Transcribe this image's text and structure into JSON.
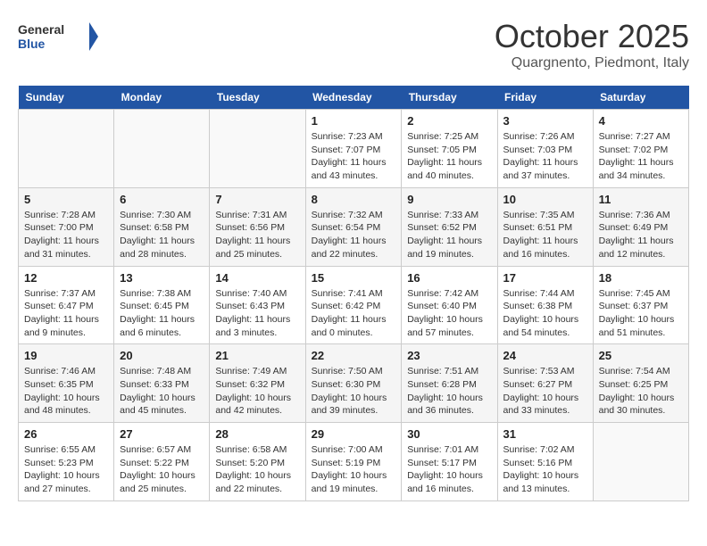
{
  "header": {
    "logo_general": "General",
    "logo_blue": "Blue",
    "month_title": "October 2025",
    "subtitle": "Quargnento, Piedmont, Italy"
  },
  "weekdays": [
    "Sunday",
    "Monday",
    "Tuesday",
    "Wednesday",
    "Thursday",
    "Friday",
    "Saturday"
  ],
  "weeks": [
    [
      {
        "day": "",
        "info": ""
      },
      {
        "day": "",
        "info": ""
      },
      {
        "day": "",
        "info": ""
      },
      {
        "day": "1",
        "info": "Sunrise: 7:23 AM\nSunset: 7:07 PM\nDaylight: 11 hours and 43 minutes."
      },
      {
        "day": "2",
        "info": "Sunrise: 7:25 AM\nSunset: 7:05 PM\nDaylight: 11 hours and 40 minutes."
      },
      {
        "day": "3",
        "info": "Sunrise: 7:26 AM\nSunset: 7:03 PM\nDaylight: 11 hours and 37 minutes."
      },
      {
        "day": "4",
        "info": "Sunrise: 7:27 AM\nSunset: 7:02 PM\nDaylight: 11 hours and 34 minutes."
      }
    ],
    [
      {
        "day": "5",
        "info": "Sunrise: 7:28 AM\nSunset: 7:00 PM\nDaylight: 11 hours and 31 minutes."
      },
      {
        "day": "6",
        "info": "Sunrise: 7:30 AM\nSunset: 6:58 PM\nDaylight: 11 hours and 28 minutes."
      },
      {
        "day": "7",
        "info": "Sunrise: 7:31 AM\nSunset: 6:56 PM\nDaylight: 11 hours and 25 minutes."
      },
      {
        "day": "8",
        "info": "Sunrise: 7:32 AM\nSunset: 6:54 PM\nDaylight: 11 hours and 22 minutes."
      },
      {
        "day": "9",
        "info": "Sunrise: 7:33 AM\nSunset: 6:52 PM\nDaylight: 11 hours and 19 minutes."
      },
      {
        "day": "10",
        "info": "Sunrise: 7:35 AM\nSunset: 6:51 PM\nDaylight: 11 hours and 16 minutes."
      },
      {
        "day": "11",
        "info": "Sunrise: 7:36 AM\nSunset: 6:49 PM\nDaylight: 11 hours and 12 minutes."
      }
    ],
    [
      {
        "day": "12",
        "info": "Sunrise: 7:37 AM\nSunset: 6:47 PM\nDaylight: 11 hours and 9 minutes."
      },
      {
        "day": "13",
        "info": "Sunrise: 7:38 AM\nSunset: 6:45 PM\nDaylight: 11 hours and 6 minutes."
      },
      {
        "day": "14",
        "info": "Sunrise: 7:40 AM\nSunset: 6:43 PM\nDaylight: 11 hours and 3 minutes."
      },
      {
        "day": "15",
        "info": "Sunrise: 7:41 AM\nSunset: 6:42 PM\nDaylight: 11 hours and 0 minutes."
      },
      {
        "day": "16",
        "info": "Sunrise: 7:42 AM\nSunset: 6:40 PM\nDaylight: 10 hours and 57 minutes."
      },
      {
        "day": "17",
        "info": "Sunrise: 7:44 AM\nSunset: 6:38 PM\nDaylight: 10 hours and 54 minutes."
      },
      {
        "day": "18",
        "info": "Sunrise: 7:45 AM\nSunset: 6:37 PM\nDaylight: 10 hours and 51 minutes."
      }
    ],
    [
      {
        "day": "19",
        "info": "Sunrise: 7:46 AM\nSunset: 6:35 PM\nDaylight: 10 hours and 48 minutes."
      },
      {
        "day": "20",
        "info": "Sunrise: 7:48 AM\nSunset: 6:33 PM\nDaylight: 10 hours and 45 minutes."
      },
      {
        "day": "21",
        "info": "Sunrise: 7:49 AM\nSunset: 6:32 PM\nDaylight: 10 hours and 42 minutes."
      },
      {
        "day": "22",
        "info": "Sunrise: 7:50 AM\nSunset: 6:30 PM\nDaylight: 10 hours and 39 minutes."
      },
      {
        "day": "23",
        "info": "Sunrise: 7:51 AM\nSunset: 6:28 PM\nDaylight: 10 hours and 36 minutes."
      },
      {
        "day": "24",
        "info": "Sunrise: 7:53 AM\nSunset: 6:27 PM\nDaylight: 10 hours and 33 minutes."
      },
      {
        "day": "25",
        "info": "Sunrise: 7:54 AM\nSunset: 6:25 PM\nDaylight: 10 hours and 30 minutes."
      }
    ],
    [
      {
        "day": "26",
        "info": "Sunrise: 6:55 AM\nSunset: 5:23 PM\nDaylight: 10 hours and 27 minutes."
      },
      {
        "day": "27",
        "info": "Sunrise: 6:57 AM\nSunset: 5:22 PM\nDaylight: 10 hours and 25 minutes."
      },
      {
        "day": "28",
        "info": "Sunrise: 6:58 AM\nSunset: 5:20 PM\nDaylight: 10 hours and 22 minutes."
      },
      {
        "day": "29",
        "info": "Sunrise: 7:00 AM\nSunset: 5:19 PM\nDaylight: 10 hours and 19 minutes."
      },
      {
        "day": "30",
        "info": "Sunrise: 7:01 AM\nSunset: 5:17 PM\nDaylight: 10 hours and 16 minutes."
      },
      {
        "day": "31",
        "info": "Sunrise: 7:02 AM\nSunset: 5:16 PM\nDaylight: 10 hours and 13 minutes."
      },
      {
        "day": "",
        "info": ""
      }
    ]
  ]
}
